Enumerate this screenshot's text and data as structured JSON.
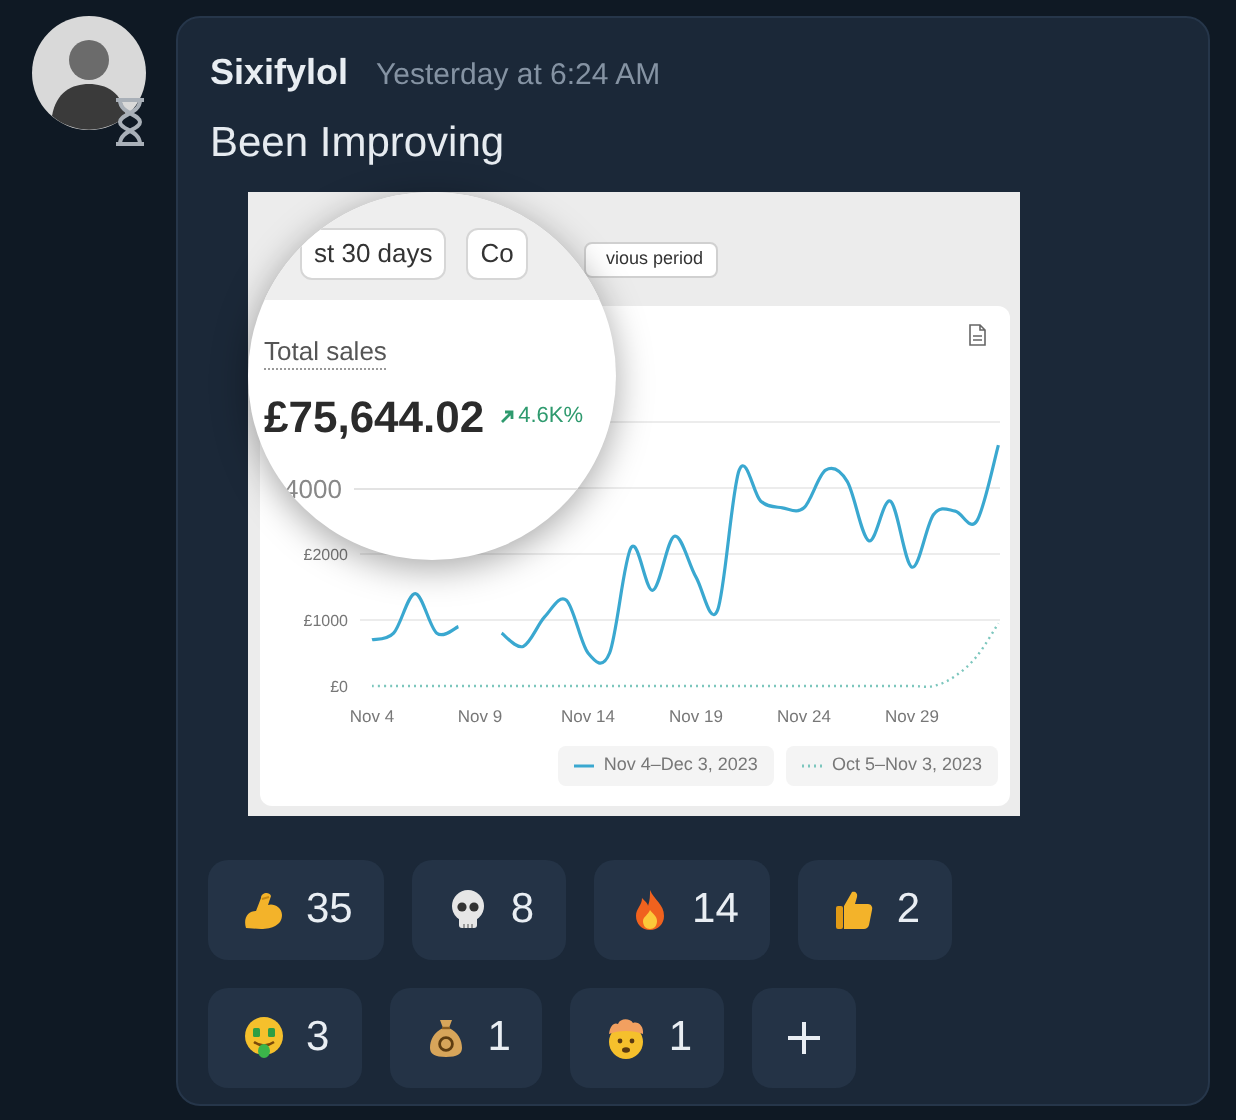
{
  "message": {
    "author": "Sixifylol",
    "timestamp": "Yesterday at 6:24 AM",
    "text": "Been Improving",
    "attachment": {
      "toolbar_buttons": [
        "vious period"
      ],
      "magnifier": {
        "buttons": [
          "st 30 days",
          "Co"
        ],
        "metric_label": "Total sales",
        "metric_value": "£75,644.02",
        "change": "4.6K%",
        "axis_label": "4000"
      },
      "chart_data": {
        "type": "line",
        "categories": [
          "Nov 4",
          null,
          null,
          null,
          null,
          "Nov 9",
          null,
          null,
          null,
          null,
          "Nov 14",
          null,
          null,
          null,
          null,
          "Nov 19",
          null,
          null,
          null,
          null,
          "Nov 24",
          null,
          null,
          null,
          null,
          "Nov 29",
          null,
          null,
          null,
          null
        ],
        "yticks": [
          {
            "value": 0,
            "label": "£0"
          },
          {
            "value": 1000,
            "label": "£1000"
          },
          {
            "value": 2000,
            "label": "£2000"
          }
        ],
        "ylim": [
          0,
          4000
        ],
        "series": [
          {
            "name": "Nov 4–Dec 3, 2023",
            "color": "#3aa8d0",
            "line_style": "solid",
            "values": [
              700,
              800,
              1400,
              800,
              900,
              null,
              800,
              600,
              1050,
              1300,
              500,
              500,
              2100,
              1450,
              2270,
              1650,
              1150,
              3270,
              2800,
              2700,
              2700,
              3270,
              3100,
              2200,
              2800,
              1800,
              2600,
              2650,
              2500,
              3650
            ]
          },
          {
            "name": "Oct 5–Nov 3, 2023",
            "color": "#7cc6bd",
            "line_style": "dotted",
            "values": [
              0,
              0,
              0,
              0,
              0,
              0,
              0,
              0,
              0,
              0,
              0,
              0,
              0,
              0,
              0,
              0,
              0,
              0,
              0,
              0,
              0,
              0,
              0,
              0,
              0,
              0,
              0,
              150,
              450,
              950
            ]
          }
        ]
      }
    }
  },
  "reactions": [
    {
      "kind": "muscle",
      "count": "35"
    },
    {
      "kind": "skull",
      "count": "8"
    },
    {
      "kind": "fire",
      "count": "14"
    },
    {
      "kind": "thumbsup",
      "count": "2"
    },
    {
      "kind": "moneyface",
      "count": "3"
    },
    {
      "kind": "moneybag",
      "count": "1"
    },
    {
      "kind": "mindblown",
      "count": "1"
    },
    {
      "kind": "add"
    }
  ]
}
